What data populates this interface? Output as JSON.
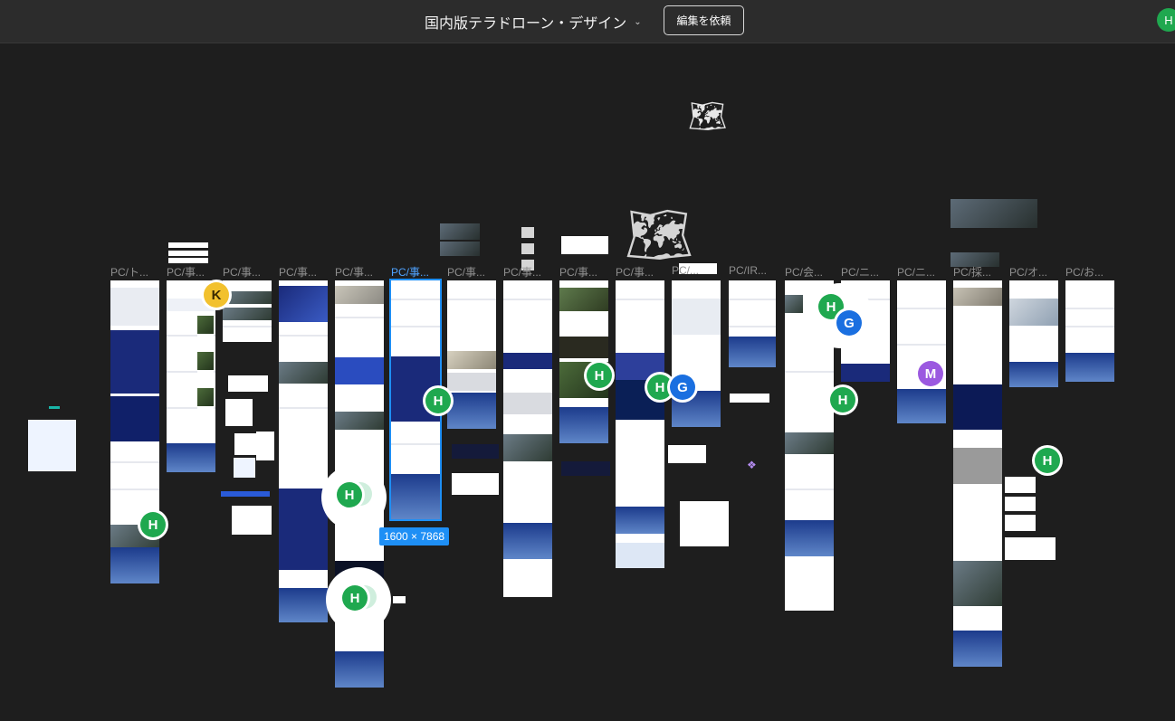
{
  "header": {
    "title": "国内版テラドローン・デザイン",
    "edit_request_label": "編集を依頼",
    "user_initial": "H"
  },
  "frames": [
    {
      "label": "PC/ト..."
    },
    {
      "label": "PC/事..."
    },
    {
      "label": "PC/事..."
    },
    {
      "label": "PC/事..."
    },
    {
      "label": "PC/事..."
    },
    {
      "label": "PC/事..."
    },
    {
      "label": "PC/事..."
    },
    {
      "label": "PC/事..."
    },
    {
      "label": "PC/事..."
    },
    {
      "label": "PC/事..."
    },
    {
      "label": "PC/..."
    },
    {
      "label": "PC/IR..."
    },
    {
      "label": "PC/会..."
    },
    {
      "label": "PC/ニ..."
    },
    {
      "label": "PC/ニ..."
    },
    {
      "label": "PC/採..."
    },
    {
      "label": "PC/オ..."
    },
    {
      "label": "PC/お..."
    }
  ],
  "selection": {
    "size": "1600 × 7868"
  },
  "collaborators": {
    "h": "H",
    "g": "G",
    "k": "K",
    "m": "M"
  },
  "colors": {
    "canvas": "#1e1e1e",
    "toolbar": "#2c2c2c",
    "selection": "#1e8ff5",
    "avatar_h": "#1fa84f",
    "avatar_g": "#1a6fe0",
    "avatar_k": "#f2c12e",
    "avatar_m": "#9b59e0"
  }
}
